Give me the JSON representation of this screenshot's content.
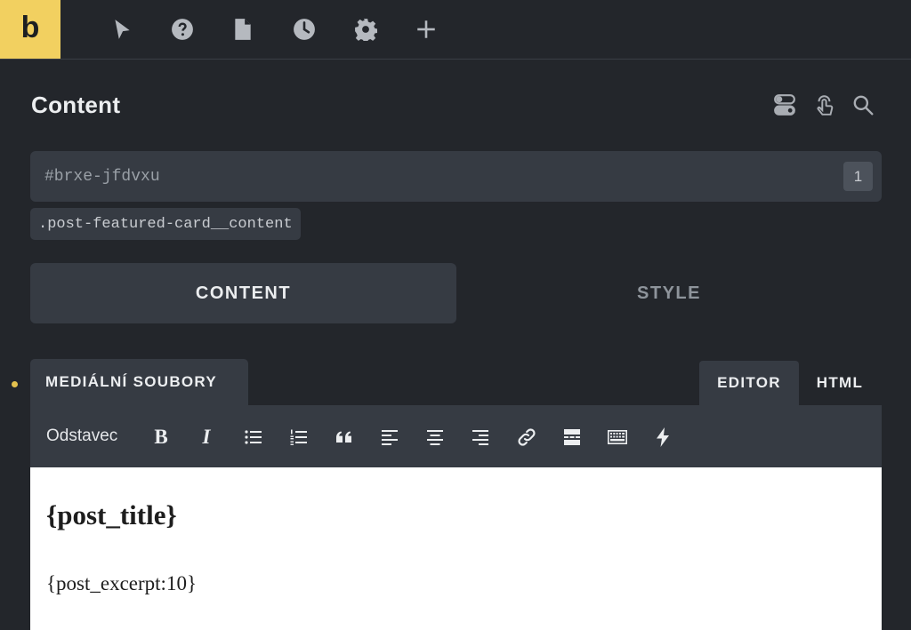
{
  "app": {
    "logo_letter": "b"
  },
  "toolbar_icons": [
    "cursor-icon",
    "help-icon",
    "page-icon",
    "history-icon",
    "settings-icon",
    "add-icon"
  ],
  "panel": {
    "title": "Content",
    "header_icons": [
      "toggle-icon",
      "touch-icon",
      "search-icon"
    ]
  },
  "element": {
    "id_value": "#brxe-jfdvxu",
    "id_badge": "1",
    "class_chip": ".post-featured-card__content"
  },
  "tabs": {
    "content": "CONTENT",
    "style": "STYLE"
  },
  "editor": {
    "media_button": "MEDIÁLNÍ SOUBORY",
    "mode_editor": "EDITOR",
    "mode_html": "HTML",
    "format_select": "Odstavec",
    "bold": "B",
    "italic": "I",
    "heading": "{post_title}",
    "paragraph": "{post_excerpt:10}"
  },
  "colors": {
    "accent": "#f2d060",
    "panel_bg": "#23262b",
    "field_bg": "#363b43"
  }
}
